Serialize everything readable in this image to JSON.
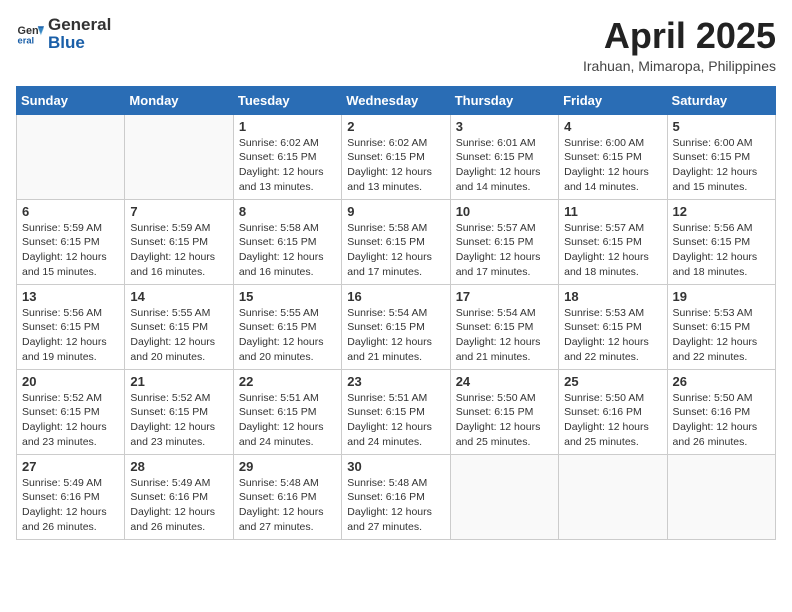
{
  "header": {
    "logo_general": "General",
    "logo_blue": "Blue",
    "month": "April 2025",
    "location": "Irahuan, Mimaropa, Philippines"
  },
  "days_of_week": [
    "Sunday",
    "Monday",
    "Tuesday",
    "Wednesday",
    "Thursday",
    "Friday",
    "Saturday"
  ],
  "weeks": [
    [
      {
        "day": "",
        "info": ""
      },
      {
        "day": "",
        "info": ""
      },
      {
        "day": "1",
        "info": "Sunrise: 6:02 AM\nSunset: 6:15 PM\nDaylight: 12 hours and 13 minutes."
      },
      {
        "day": "2",
        "info": "Sunrise: 6:02 AM\nSunset: 6:15 PM\nDaylight: 12 hours and 13 minutes."
      },
      {
        "day": "3",
        "info": "Sunrise: 6:01 AM\nSunset: 6:15 PM\nDaylight: 12 hours and 14 minutes."
      },
      {
        "day": "4",
        "info": "Sunrise: 6:00 AM\nSunset: 6:15 PM\nDaylight: 12 hours and 14 minutes."
      },
      {
        "day": "5",
        "info": "Sunrise: 6:00 AM\nSunset: 6:15 PM\nDaylight: 12 hours and 15 minutes."
      }
    ],
    [
      {
        "day": "6",
        "info": "Sunrise: 5:59 AM\nSunset: 6:15 PM\nDaylight: 12 hours and 15 minutes."
      },
      {
        "day": "7",
        "info": "Sunrise: 5:59 AM\nSunset: 6:15 PM\nDaylight: 12 hours and 16 minutes."
      },
      {
        "day": "8",
        "info": "Sunrise: 5:58 AM\nSunset: 6:15 PM\nDaylight: 12 hours and 16 minutes."
      },
      {
        "day": "9",
        "info": "Sunrise: 5:58 AM\nSunset: 6:15 PM\nDaylight: 12 hours and 17 minutes."
      },
      {
        "day": "10",
        "info": "Sunrise: 5:57 AM\nSunset: 6:15 PM\nDaylight: 12 hours and 17 minutes."
      },
      {
        "day": "11",
        "info": "Sunrise: 5:57 AM\nSunset: 6:15 PM\nDaylight: 12 hours and 18 minutes."
      },
      {
        "day": "12",
        "info": "Sunrise: 5:56 AM\nSunset: 6:15 PM\nDaylight: 12 hours and 18 minutes."
      }
    ],
    [
      {
        "day": "13",
        "info": "Sunrise: 5:56 AM\nSunset: 6:15 PM\nDaylight: 12 hours and 19 minutes."
      },
      {
        "day": "14",
        "info": "Sunrise: 5:55 AM\nSunset: 6:15 PM\nDaylight: 12 hours and 20 minutes."
      },
      {
        "day": "15",
        "info": "Sunrise: 5:55 AM\nSunset: 6:15 PM\nDaylight: 12 hours and 20 minutes."
      },
      {
        "day": "16",
        "info": "Sunrise: 5:54 AM\nSunset: 6:15 PM\nDaylight: 12 hours and 21 minutes."
      },
      {
        "day": "17",
        "info": "Sunrise: 5:54 AM\nSunset: 6:15 PM\nDaylight: 12 hours and 21 minutes."
      },
      {
        "day": "18",
        "info": "Sunrise: 5:53 AM\nSunset: 6:15 PM\nDaylight: 12 hours and 22 minutes."
      },
      {
        "day": "19",
        "info": "Sunrise: 5:53 AM\nSunset: 6:15 PM\nDaylight: 12 hours and 22 minutes."
      }
    ],
    [
      {
        "day": "20",
        "info": "Sunrise: 5:52 AM\nSunset: 6:15 PM\nDaylight: 12 hours and 23 minutes."
      },
      {
        "day": "21",
        "info": "Sunrise: 5:52 AM\nSunset: 6:15 PM\nDaylight: 12 hours and 23 minutes."
      },
      {
        "day": "22",
        "info": "Sunrise: 5:51 AM\nSunset: 6:15 PM\nDaylight: 12 hours and 24 minutes."
      },
      {
        "day": "23",
        "info": "Sunrise: 5:51 AM\nSunset: 6:15 PM\nDaylight: 12 hours and 24 minutes."
      },
      {
        "day": "24",
        "info": "Sunrise: 5:50 AM\nSunset: 6:15 PM\nDaylight: 12 hours and 25 minutes."
      },
      {
        "day": "25",
        "info": "Sunrise: 5:50 AM\nSunset: 6:16 PM\nDaylight: 12 hours and 25 minutes."
      },
      {
        "day": "26",
        "info": "Sunrise: 5:50 AM\nSunset: 6:16 PM\nDaylight: 12 hours and 26 minutes."
      }
    ],
    [
      {
        "day": "27",
        "info": "Sunrise: 5:49 AM\nSunset: 6:16 PM\nDaylight: 12 hours and 26 minutes."
      },
      {
        "day": "28",
        "info": "Sunrise: 5:49 AM\nSunset: 6:16 PM\nDaylight: 12 hours and 26 minutes."
      },
      {
        "day": "29",
        "info": "Sunrise: 5:48 AM\nSunset: 6:16 PM\nDaylight: 12 hours and 27 minutes."
      },
      {
        "day": "30",
        "info": "Sunrise: 5:48 AM\nSunset: 6:16 PM\nDaylight: 12 hours and 27 minutes."
      },
      {
        "day": "",
        "info": ""
      },
      {
        "day": "",
        "info": ""
      },
      {
        "day": "",
        "info": ""
      }
    ]
  ]
}
